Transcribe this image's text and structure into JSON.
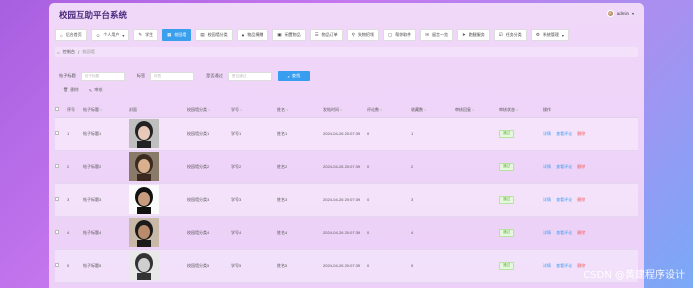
{
  "app": {
    "title": "校园互助平台系统"
  },
  "user": {
    "name": "admin"
  },
  "nav": [
    {
      "label": "后台首页",
      "icon": "home-icon"
    },
    {
      "label": "个人用户",
      "icon": "user-icon",
      "caret": "▾"
    },
    {
      "label": "学生",
      "icon": "student-icon"
    },
    {
      "label": "校园墙",
      "icon": "wall-icon",
      "active": true
    },
    {
      "label": "校园墙分类",
      "icon": "category-icon"
    },
    {
      "label": "物品捐赠",
      "icon": "donate-icon"
    },
    {
      "label": "闲置物品",
      "icon": "item-icon"
    },
    {
      "label": "物品订单",
      "icon": "order-icon"
    },
    {
      "label": "失物招领",
      "icon": "lost-icon"
    },
    {
      "label": "帮你取件",
      "icon": "parcel-icon"
    },
    {
      "label": "留言一览",
      "icon": "message-icon"
    },
    {
      "label": "跑腿服务",
      "icon": "errand-icon"
    },
    {
      "label": "任务分类",
      "icon": "task-icon"
    },
    {
      "label": "系统管理",
      "icon": "settings-icon",
      "caret": "▾"
    }
  ],
  "breadcrumb": {
    "home": "控制台",
    "sep": "/",
    "current": "校园墙"
  },
  "search": {
    "fields": [
      {
        "label": "帖子标题",
        "placeholder": "帖子标题"
      },
      {
        "label": "标签",
        "placeholder": "标签"
      },
      {
        "label": "是否通过",
        "placeholder": "是否通过"
      }
    ],
    "button": "查找"
  },
  "actions": {
    "delete": "删除",
    "review": "审核"
  },
  "table": {
    "headers": [
      "序号",
      "帖子标题",
      "封面",
      "校园墙分类",
      "学号",
      "姓名",
      "发帖时间",
      "评论数",
      "收藏数",
      "审核回复",
      "审核状态",
      "操作"
    ],
    "rows": [
      {
        "no": "1",
        "title": "帖子标题1",
        "cat": "校园墙分类1",
        "sid": "学号1",
        "name": "姓名1",
        "time": "2024-04-26 20:07:39",
        "comments": "0",
        "fav": "1",
        "reply": "",
        "status": "通过"
      },
      {
        "no": "2",
        "title": "帖子标题2",
        "cat": "校园墙分类2",
        "sid": "学号2",
        "name": "姓名2",
        "time": "2024-04-26 20:07:39",
        "comments": "0",
        "fav": "2",
        "reply": "",
        "status": "通过"
      },
      {
        "no": "3",
        "title": "帖子标题3",
        "cat": "校园墙分类3",
        "sid": "学号3",
        "name": "姓名3",
        "time": "2024-04-26 20:07:39",
        "comments": "0",
        "fav": "3",
        "reply": "",
        "status": "通过"
      },
      {
        "no": "4",
        "title": "帖子标题4",
        "cat": "校园墙分类4",
        "sid": "学号4",
        "name": "姓名4",
        "time": "2024-04-26 20:07:39",
        "comments": "0",
        "fav": "4",
        "reply": "",
        "status": "通过"
      },
      {
        "no": "5",
        "title": "帖子标题5",
        "cat": "校园墙分类5",
        "sid": "学号5",
        "name": "姓名5",
        "time": "2024-04-26 20:07:39",
        "comments": "0",
        "fav": "5",
        "reply": "",
        "status": "通过"
      }
    ],
    "ops": {
      "detail": "详情",
      "comments": "查看评论",
      "delete": "删除"
    }
  },
  "watermark": "CSDN @黄建程序设计"
}
